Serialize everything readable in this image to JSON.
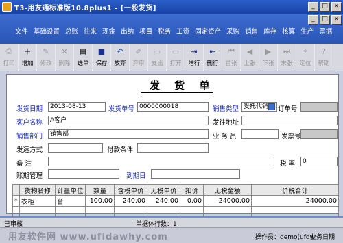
{
  "window": {
    "title": "T3-用友通标准版10.8plus1 - [一般发货]",
    "buttons": [
      "_",
      "□",
      "×"
    ],
    "mdi_buttons": [
      "_",
      "□",
      "×"
    ]
  },
  "menu": [
    "文件",
    "基础设置",
    "总账",
    "往来",
    "现金",
    "出纳",
    "项目",
    "税务",
    "工资",
    "固定资产",
    "采购",
    "销售",
    "库存",
    "核算",
    "生产",
    "票据"
  ],
  "toolbar": [
    {
      "label": "打印",
      "icon": "print-icon",
      "enabled": false
    },
    {
      "label": "增加",
      "icon": "add-icon",
      "enabled": true
    },
    {
      "label": "修改",
      "icon": "edit-icon",
      "enabled": false
    },
    {
      "label": "删除",
      "icon": "delete-icon",
      "enabled": false
    },
    {
      "label": "选单",
      "icon": "select-icon",
      "enabled": true
    },
    {
      "label": "保存",
      "icon": "save-icon",
      "enabled": true
    },
    {
      "label": "放弃",
      "icon": "discard-icon",
      "enabled": true
    },
    {
      "label": "弃审",
      "icon": "unaudit-icon",
      "enabled": false
    },
    {
      "label": "支出",
      "icon": "expense-icon",
      "enabled": false
    },
    {
      "label": "打开",
      "icon": "open-icon",
      "enabled": false
    },
    {
      "label": "增行",
      "icon": "add-row-icon",
      "enabled": true
    },
    {
      "label": "删行",
      "icon": "delete-row-icon",
      "enabled": true
    },
    {
      "label": "首张",
      "icon": "first-icon",
      "enabled": false
    },
    {
      "label": "上张",
      "icon": "prev-icon",
      "enabled": false
    },
    {
      "label": "下张",
      "icon": "next-icon",
      "enabled": false
    },
    {
      "label": "末张",
      "icon": "last-icon",
      "enabled": false
    },
    {
      "label": "定位",
      "icon": "locate-icon",
      "enabled": false
    },
    {
      "label": "帮助",
      "icon": "help-icon",
      "enabled": false
    }
  ],
  "form": {
    "title": "发 货 单",
    "ship_date_label": "发货日期",
    "ship_date": "2013-08-13",
    "ship_no_label": "发货单号",
    "ship_no": "0000000018",
    "sales_type_label": "销售类型",
    "sales_type": "受托代销",
    "order_no_label": "订单号",
    "order_no": "",
    "customer_label": "客户名称",
    "customer": "A客户",
    "ship_addr_label": "发往地址",
    "ship_addr": "",
    "dept_label": "销售部门",
    "dept": "销售部",
    "salesman_label": "业 务 员",
    "salesman": "",
    "invoice_no_label": "发票号",
    "invoice_no": "",
    "ship_method_label": "发运方式",
    "ship_method": "",
    "pay_terms_label": "付款条件",
    "pay_terms": "",
    "remark_label": "备    注",
    "remark": "",
    "tax_rate_label": "税  率",
    "tax_rate": "0",
    "account_mgmt_label": "账期管理",
    "account_mgmt": "",
    "due_date_label": "到期日",
    "due_date": ""
  },
  "table": {
    "headers": [
      "货物名称",
      "计量单位",
      "数量",
      "含税单价",
      "无税单价",
      "扣价",
      "无税金额",
      "价税合计"
    ],
    "rows": [
      {
        "marker": "*",
        "name": "衣柜",
        "unit": "台",
        "qty": "100.00",
        "tax_price": "240.00",
        "notax_price": "240.00",
        "discount": "0.00",
        "notax_amount": "24000.00",
        "total": "24000.00"
      }
    ]
  },
  "status": {
    "audited": "已审核",
    "row_count": "单据体行数：1",
    "operator": "操作员：demo(ufdw",
    "module": "业务日期"
  },
  "watermark": "用友软件网 www.ufidawhy.com"
}
